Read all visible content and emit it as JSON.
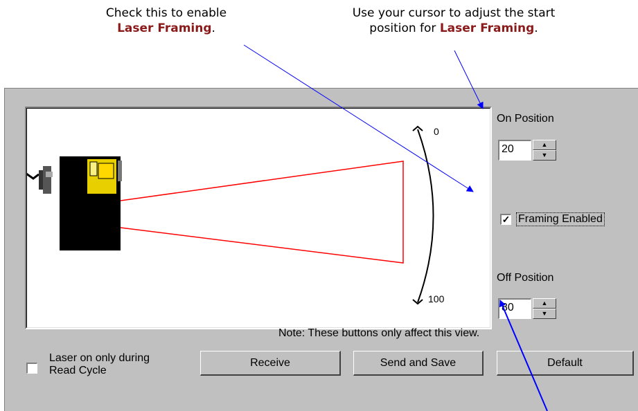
{
  "callouts": {
    "left": {
      "line1": "Check this to enable",
      "highlight": "Laser Framing",
      "suffix": "."
    },
    "right": {
      "line1": "Use your cursor to adjust the start",
      "line2_prefix": "position for ",
      "highlight": "Laser Framing",
      "suffix": "."
    }
  },
  "framing": {
    "on_position_label": "On Position",
    "on_position_value": "20",
    "framing_enabled_label": "Framing Enabled",
    "framing_enabled_checked": true,
    "off_position_label": "Off Position",
    "off_position_value": "80",
    "scale_min_label": "0",
    "scale_max_label": "100"
  },
  "options": {
    "laser_read_cycle_label_line1": "Laser on only during",
    "laser_read_cycle_label_line2": "Read Cycle",
    "laser_read_cycle_checked": false
  },
  "buttons": {
    "receive": "Receive",
    "send_and_save": "Send and Save",
    "default": "Default"
  },
  "note": "Note: These buttons only affect this view.",
  "colors": {
    "callout_highlight": "#8b1a1a",
    "arrow": "#0000ff",
    "beam": "#ff0000",
    "panel": "#c0c0c0"
  },
  "icons": [
    "scanner-icon",
    "spin-up-icon",
    "spin-down-icon",
    "checkmark-icon"
  ]
}
